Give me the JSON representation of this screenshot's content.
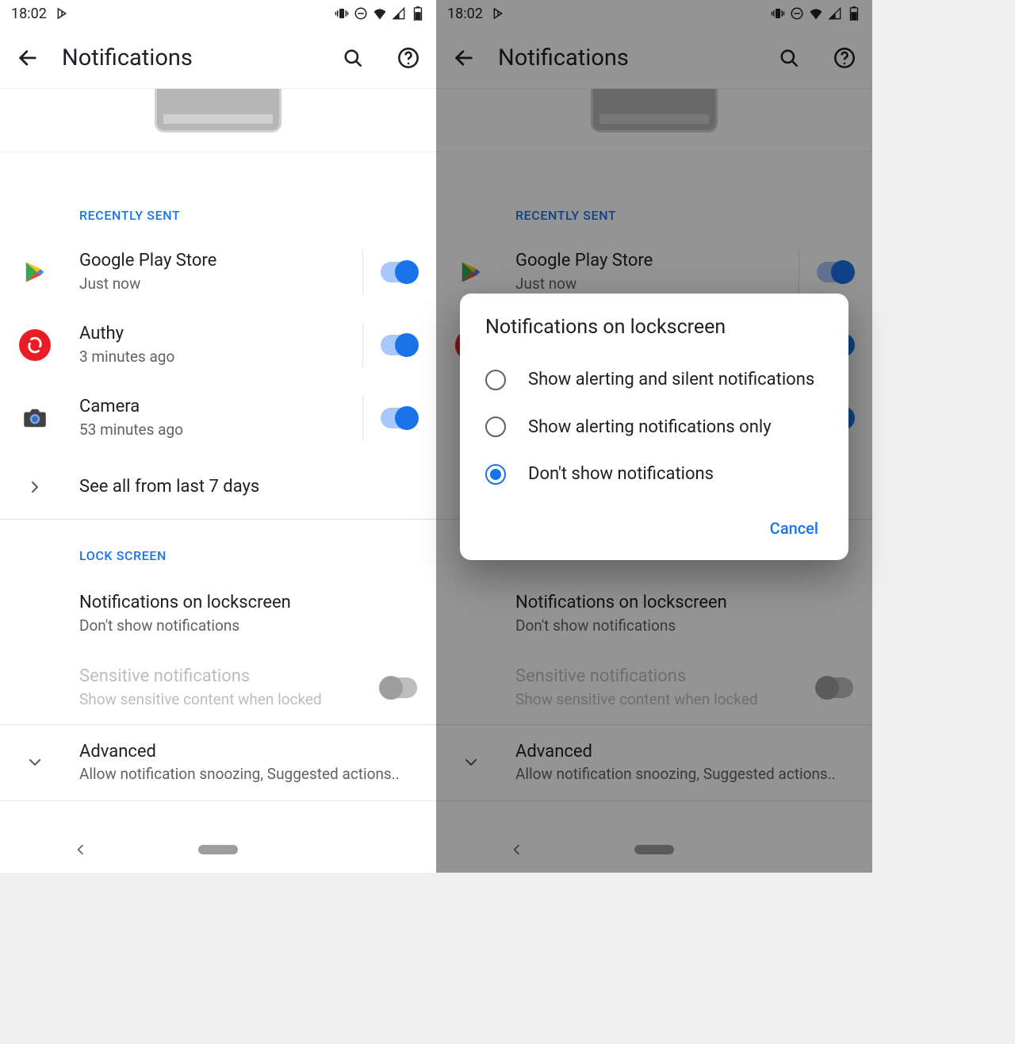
{
  "status": {
    "time": "18:02"
  },
  "appbar": {
    "title": "Notifications"
  },
  "recently_sent": {
    "header": "RECENTLY SENT",
    "items": [
      {
        "name": "Google Play Store",
        "sub": "Just now"
      },
      {
        "name": "Authy",
        "sub": "3 minutes ago"
      },
      {
        "name": "Camera",
        "sub": "53 minutes ago"
      }
    ],
    "see_all": "See all from last 7 days"
  },
  "lock_screen": {
    "header": "LOCK SCREEN",
    "notif_title": "Notifications on lockscreen",
    "notif_sub": "Don't show notifications",
    "sensitive_title": "Sensitive notifications",
    "sensitive_sub": "Show sensitive content when locked"
  },
  "advanced": {
    "title": "Advanced",
    "sub": "Allow notification snoozing, Suggested actions.."
  },
  "dialog": {
    "title": "Notifications on lockscreen",
    "options": [
      "Show alerting and silent notifications",
      "Show alerting notifications only",
      "Don't show notifications"
    ],
    "selected_index": 2,
    "cancel": "Cancel"
  }
}
